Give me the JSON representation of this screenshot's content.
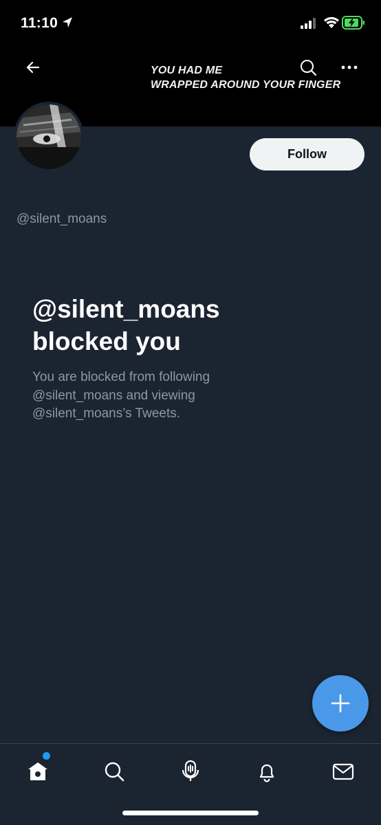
{
  "status_bar": {
    "time": "11:10"
  },
  "header": {
    "banner_line1": "YOU HAD ME",
    "banner_line2": "WRAPPED AROUND YOUR FINGER"
  },
  "profile": {
    "handle": "@silent_moans",
    "follow_label": "Follow"
  },
  "blocked": {
    "title_line1": "@silent_moans",
    "title_line2": "blocked you",
    "description": "You are blocked from following @silent_moans and viewing @silent_moans’s Tweets."
  },
  "colors": {
    "background": "#1b2431",
    "banner": "#000000",
    "accent": "#4a99e9",
    "secondary_text": "#8b98a5"
  },
  "tabs": [
    {
      "icon": "home-icon"
    },
    {
      "icon": "search-icon"
    },
    {
      "icon": "spaces-icon"
    },
    {
      "icon": "notifications-icon"
    },
    {
      "icon": "messages-icon"
    }
  ]
}
